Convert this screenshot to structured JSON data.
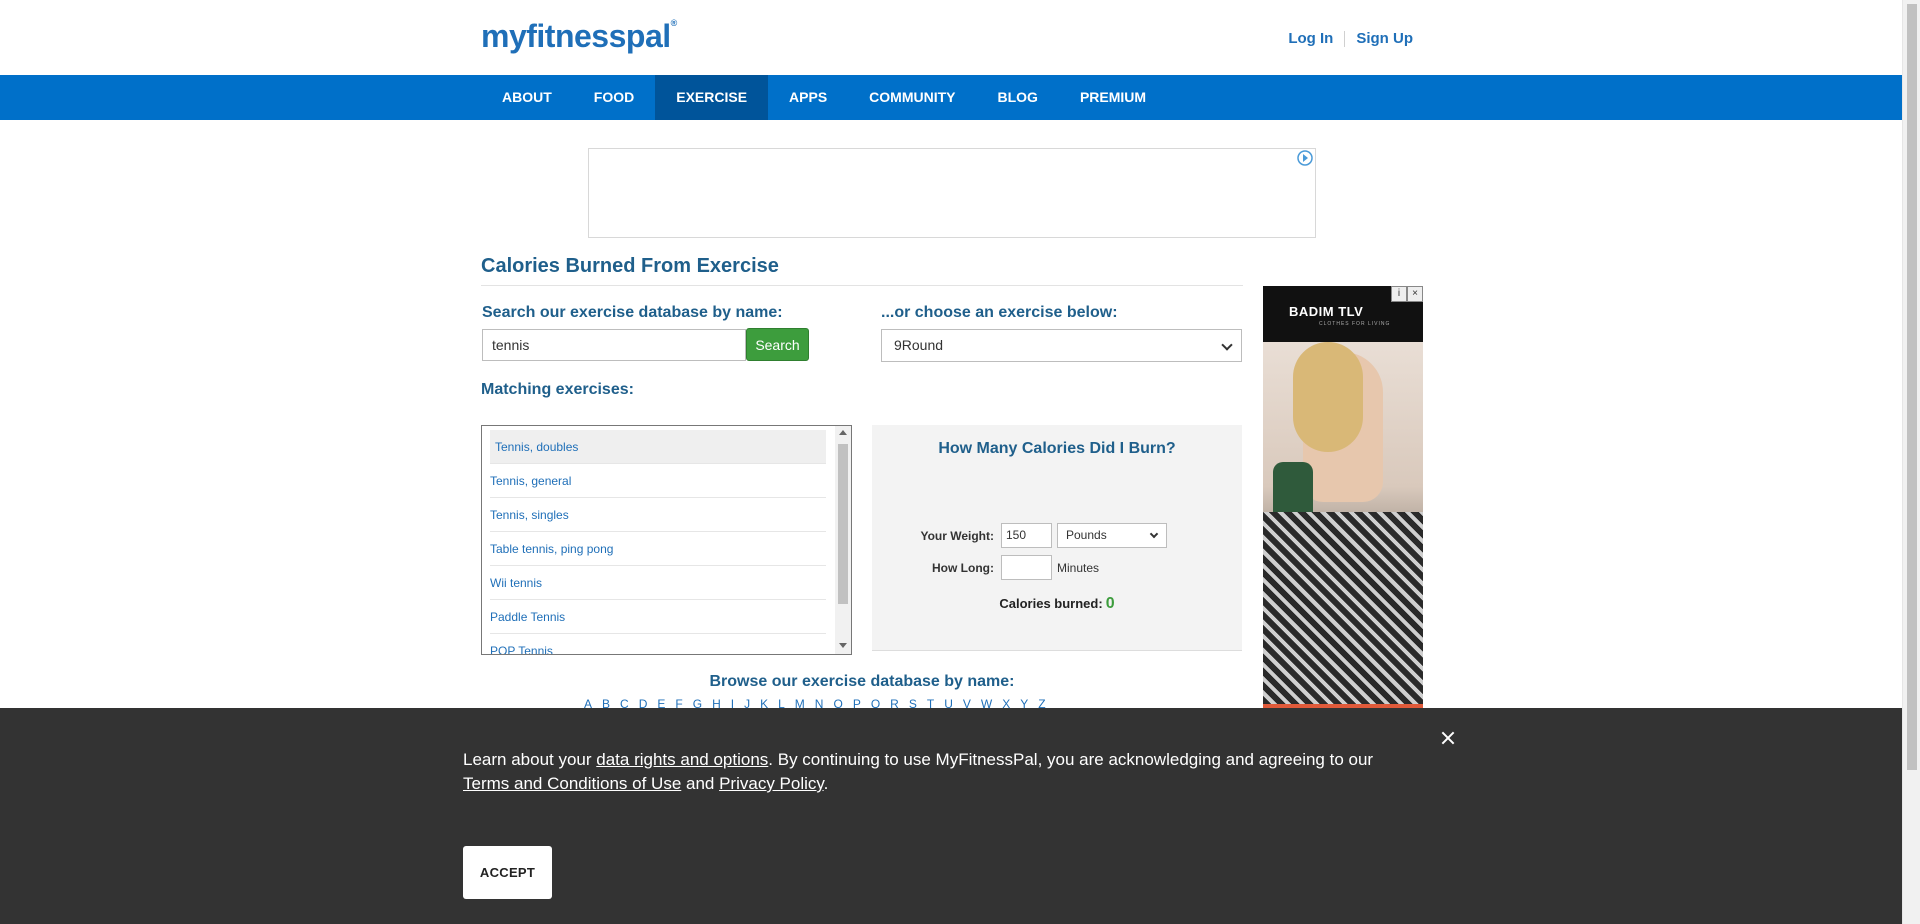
{
  "header": {
    "logo": "myfitnesspal",
    "logo_mark": "®",
    "login": "Log In",
    "signup": "Sign Up"
  },
  "nav": {
    "items": [
      "ABOUT",
      "FOOD",
      "EXERCISE",
      "APPS",
      "COMMUNITY",
      "BLOG",
      "PREMIUM"
    ],
    "active": "EXERCISE"
  },
  "main": {
    "title": "Calories Burned From Exercise",
    "search_label": "Search our exercise database by name:",
    "search_value": "tennis",
    "search_button": "Search",
    "choose_label": "...or choose an exercise below:",
    "choose_selected": "9Round",
    "matching_label": "Matching exercises:",
    "matches": [
      "Tennis, doubles",
      "Tennis, general",
      "Tennis, singles",
      "Table tennis, ping pong",
      "Wii tennis",
      "Paddle Tennis",
      "POP Tennis"
    ],
    "calc": {
      "title": "How Many Calories Did I Burn?",
      "weight_label": "Your Weight:",
      "weight_value": "150",
      "weight_unit": "Pounds",
      "long_label": "How Long:",
      "long_value": "",
      "minutes_label": "Minutes",
      "burned_label": "Calories burned:",
      "burned_value": "0"
    },
    "browse_label": "Browse our exercise database by name:",
    "letters": [
      "A",
      "B",
      "C",
      "D",
      "E",
      "F",
      "G",
      "H",
      "I",
      "J",
      "K",
      "L",
      "M",
      "N",
      "O",
      "P",
      "Q",
      "R",
      "S",
      "T",
      "U",
      "V",
      "W",
      "X",
      "Y",
      "Z"
    ]
  },
  "side_ad": {
    "brand": "BADIM TLV",
    "tagline": "CLOTHES FOR LIVING"
  },
  "cookie": {
    "text_1": "Learn about your ",
    "link_rights": "data rights and options",
    "text_2": ". By continuing to use MyFitnessPal, you are acknowledging and agreeing to our ",
    "link_terms": "Terms and Conditions of Use",
    "text_3": " and ",
    "link_privacy": "Privacy Policy",
    "text_4": ".",
    "accept": "ACCEPT"
  },
  "colors": {
    "nav": "#0070c9",
    "nav_active": "#00549a",
    "brand_blue": "#1f6fb8",
    "heading_blue": "#1f5f8b",
    "search_green": "#3d9d3d",
    "cookie_bg": "#333333"
  }
}
